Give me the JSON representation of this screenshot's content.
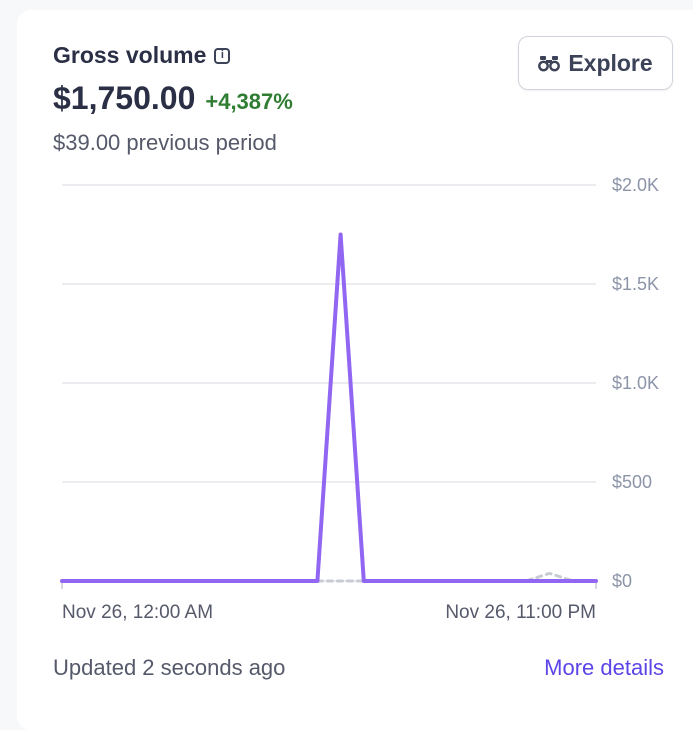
{
  "card": {
    "title": "Gross volume",
    "amount": "$1,750.00",
    "change": "+4,387%",
    "previous": "$39.00 previous period",
    "explore_label": "Explore",
    "updated": "Updated 2 seconds ago",
    "more_details": "More details"
  },
  "colors": {
    "current_line": "#9166f2",
    "previous_line": "#c7cbd4",
    "positive_change": "#2e7d32",
    "link": "#5b45e8"
  },
  "icons": {
    "info": "info-icon",
    "explore": "binoculars-icon"
  },
  "chart_data": {
    "type": "line",
    "ylim": [
      0,
      2000
    ],
    "y_ticks": [
      {
        "value": 2000,
        "label": "$2.0K"
      },
      {
        "value": 1500,
        "label": "$1.5K"
      },
      {
        "value": 1000,
        "label": "$1.0K"
      },
      {
        "value": 500,
        "label": "$500"
      },
      {
        "value": 0,
        "label": "$0"
      }
    ],
    "x_labels": {
      "start": "Nov 26, 12:00 AM",
      "end": "Nov 26, 11:00 PM"
    },
    "x_hours": [
      0,
      23
    ],
    "grid": true,
    "series": [
      {
        "style": "solid",
        "x": [
          0,
          2,
          4,
          6,
          8,
          9,
          10,
          11,
          12,
          13,
          14,
          15,
          16,
          18,
          20,
          22,
          23
        ],
        "values": [
          0,
          0,
          0,
          0,
          0,
          0,
          0,
          0,
          1750,
          0,
          0,
          0,
          0,
          0,
          0,
          0,
          0
        ],
        "range": [
          0,
          13
        ]
      },
      {
        "style": "dashed",
        "x": [
          11,
          12,
          13,
          14,
          15,
          16,
          17,
          18,
          19,
          20,
          21,
          22,
          23
        ],
        "values": [
          0,
          0,
          0,
          0,
          0,
          0,
          0,
          0,
          0,
          0,
          39,
          0,
          0
        ]
      }
    ]
  }
}
